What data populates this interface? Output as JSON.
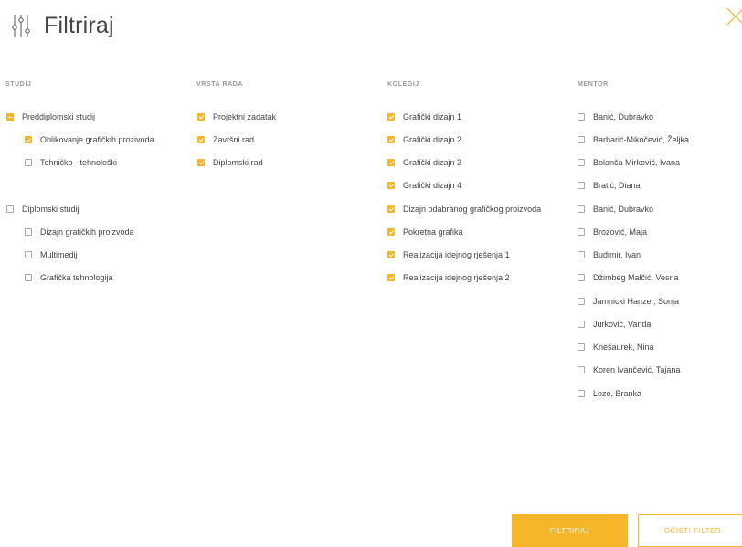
{
  "header": {
    "title": "Filtriraj",
    "icon": "filter-sliders-icon",
    "close_icon": "close-icon"
  },
  "colors": {
    "accent": "#f6b62a",
    "text": "#444444",
    "muted": "#9a9a9a"
  },
  "columns": {
    "studij": {
      "heading": "STUDIJ",
      "items": [
        {
          "label": "Preddiplomski studij",
          "state": "partial"
        },
        {
          "label": "Oblikovanje grafičkih prozivoda",
          "state": "checked"
        },
        {
          "label": "Tehničko - tehnološki",
          "state": "unchecked"
        },
        {
          "label": "Diplomski studij",
          "state": "unchecked"
        },
        {
          "label": "Dizajn grafičkih proizvoda",
          "state": "unchecked"
        },
        {
          "label": "Multimedij",
          "state": "unchecked"
        },
        {
          "label": "Grafička tehnologija",
          "state": "unchecked"
        }
      ]
    },
    "vrsta_rada": {
      "heading": "VRSTA RADA",
      "items": [
        {
          "label": "Projektni zadatak",
          "state": "checked"
        },
        {
          "label": "Završni rad",
          "state": "checked"
        },
        {
          "label": "Diplomski rad",
          "state": "checked"
        }
      ]
    },
    "kolegij": {
      "heading": "KOLEGIJ",
      "items": [
        {
          "label": "Grafički dizajn 1",
          "state": "checked"
        },
        {
          "label": "Grafički dizajn 2",
          "state": "checked"
        },
        {
          "label": "Grafički dizajn 3",
          "state": "checked"
        },
        {
          "label": "Grafički dizajn 4",
          "state": "checked"
        },
        {
          "label": "Dizajn odabranog grafičkog proizvoda",
          "state": "checked"
        },
        {
          "label": "Pokretna grafika",
          "state": "checked"
        },
        {
          "label": "Realizacija idejnog rješenja 1",
          "state": "checked"
        },
        {
          "label": "Realizacija idejnog rješenja 2",
          "state": "checked"
        }
      ]
    },
    "mentor": {
      "heading": "MENTOR",
      "items": [
        {
          "label": "Banić, Dubravko",
          "state": "unchecked"
        },
        {
          "label": "Barbarić-Mikočević, Željka",
          "state": "unchecked"
        },
        {
          "label": "Bolanča Mirković, Ivana",
          "state": "unchecked"
        },
        {
          "label": "Bratić, Diana",
          "state": "unchecked"
        },
        {
          "label": "Banić, Dubravko",
          "state": "unchecked"
        },
        {
          "label": "Brozović, Maja",
          "state": "unchecked"
        },
        {
          "label": "Budimir, Ivan",
          "state": "unchecked"
        },
        {
          "label": "Džimbeg Malčić, Vesna",
          "state": "unchecked"
        },
        {
          "label": "Jamnicki Hanzer, Sonja",
          "state": "unchecked"
        },
        {
          "label": "Jurković, Vanda",
          "state": "unchecked"
        },
        {
          "label": "Knešaurek, Nina",
          "state": "unchecked"
        },
        {
          "label": "Koren Ivančević, Tajana",
          "state": "unchecked"
        },
        {
          "label": "Lozo, Branka",
          "state": "unchecked"
        }
      ]
    }
  },
  "buttons": {
    "apply": "FILTRIRAJ",
    "clear": "OČISTI FILTER"
  }
}
